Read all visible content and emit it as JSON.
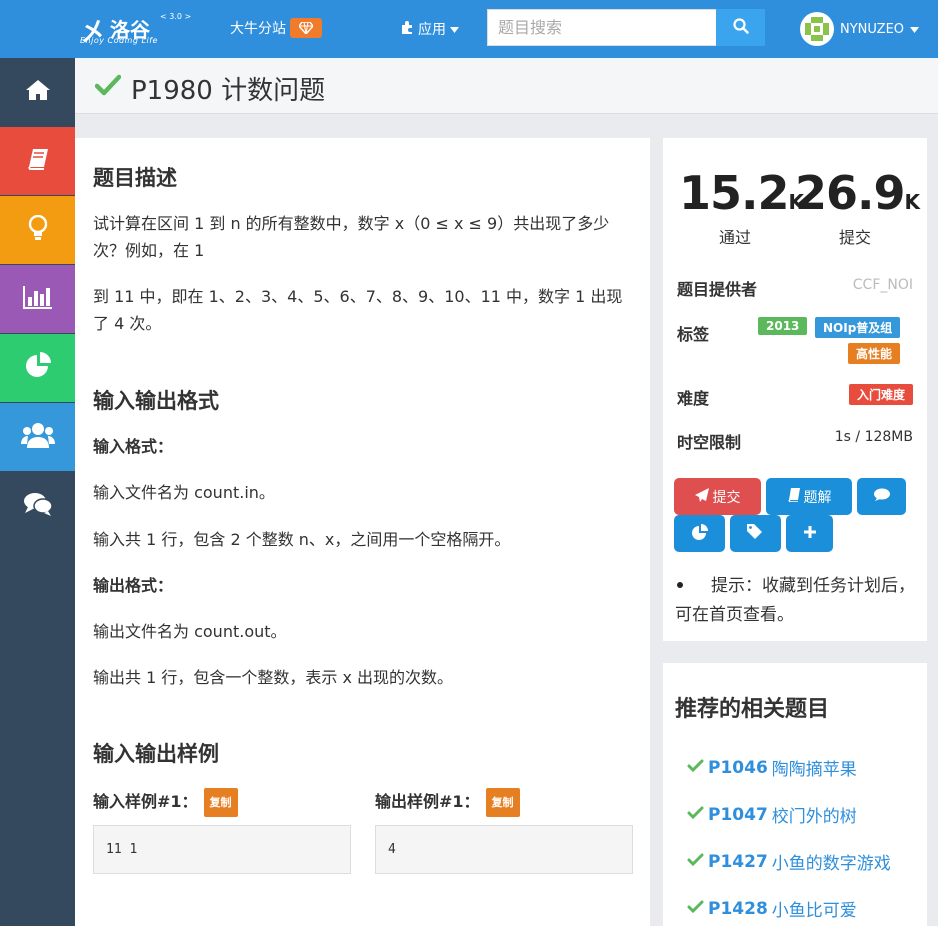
{
  "header": {
    "logo_mark": "㐅",
    "logo_text": "洛谷",
    "logo_version": "< 3.0 >",
    "logo_sub": "Enjoy Coding Life",
    "branch": "大牛分站",
    "apps_label": "应用",
    "search_placeholder": "题目搜索",
    "username": "NYNUZEO"
  },
  "sidebar": {
    "items": [
      {
        "name": "home",
        "color": "#34495e"
      },
      {
        "name": "book",
        "color": "#e74c3c"
      },
      {
        "name": "bulb",
        "color": "#f39c12"
      },
      {
        "name": "chart",
        "color": "#9b59b6"
      },
      {
        "name": "pie",
        "color": "#2ecc71"
      },
      {
        "name": "users",
        "color": "#3498db"
      },
      {
        "name": "comments",
        "color": "#34495e"
      }
    ]
  },
  "problem": {
    "title": "P1980 计数问题",
    "desc_heading": "题目描述",
    "desc_p1": "试计算在区间 1 到 n 的所有整数中，数字 x（0 ≤ x ≤ 9）共出现了多少次？例如，在 1",
    "desc_p2": "到 11 中，即在 1、2、3、4、5、6、7、8、9、10、11 中，数字 1 出现了 4 次。",
    "io_heading": "输入输出格式",
    "input_format_label": "输入格式：",
    "input_line1": "输入文件名为 count.in。",
    "input_line2": "输入共 1 行，包含 2 个整数 n、x，之间用一个空格隔开。",
    "output_format_label": "输出格式：",
    "output_line1": "输出文件名为 count.out。",
    "output_line2": "输出共 1 行，包含一个整数，表示 x 出现的次数。",
    "sample_heading": "输入输出样例",
    "sample_in_label": "输入样例#1：",
    "sample_out_label": "输出样例#1：",
    "copy_label": "复制",
    "sample_in": "11 1",
    "sample_out": "4"
  },
  "info": {
    "passed_num": "15.2",
    "passed_unit": "K",
    "passed_label": "通过",
    "submitted_num": "26.9",
    "submitted_unit": "K",
    "submitted_label": "提交",
    "provider_label": "题目提供者",
    "provider": "CCF_NOI",
    "tags_label": "标签",
    "tags": [
      "2013",
      "NOIp普及组",
      "高性能"
    ],
    "difficulty_label": "难度",
    "difficulty": "入门难度",
    "limit_label": "时空限制",
    "limit": "1s / 128MB",
    "btn_submit": "提交",
    "btn_solution": "题解",
    "tip": "提示：收藏到任务计划后，可在首页查看。",
    "colors": {
      "green_tag": "#5cb85c",
      "blue_tag": "#3498db",
      "orange_tag": "#e67e22",
      "red_tag": "#e74c3c",
      "btn_red": "#e04f4f",
      "btn_blue": "#1b8fd9"
    }
  },
  "recommend": {
    "title": "推荐的相关题目",
    "items": [
      {
        "id": "P1046",
        "name": "陶陶摘苹果"
      },
      {
        "id": "P1047",
        "name": "校门外的树"
      },
      {
        "id": "P1427",
        "name": "小鱼的数字游戏"
      },
      {
        "id": "P1428",
        "name": "小鱼比可爱"
      }
    ]
  }
}
